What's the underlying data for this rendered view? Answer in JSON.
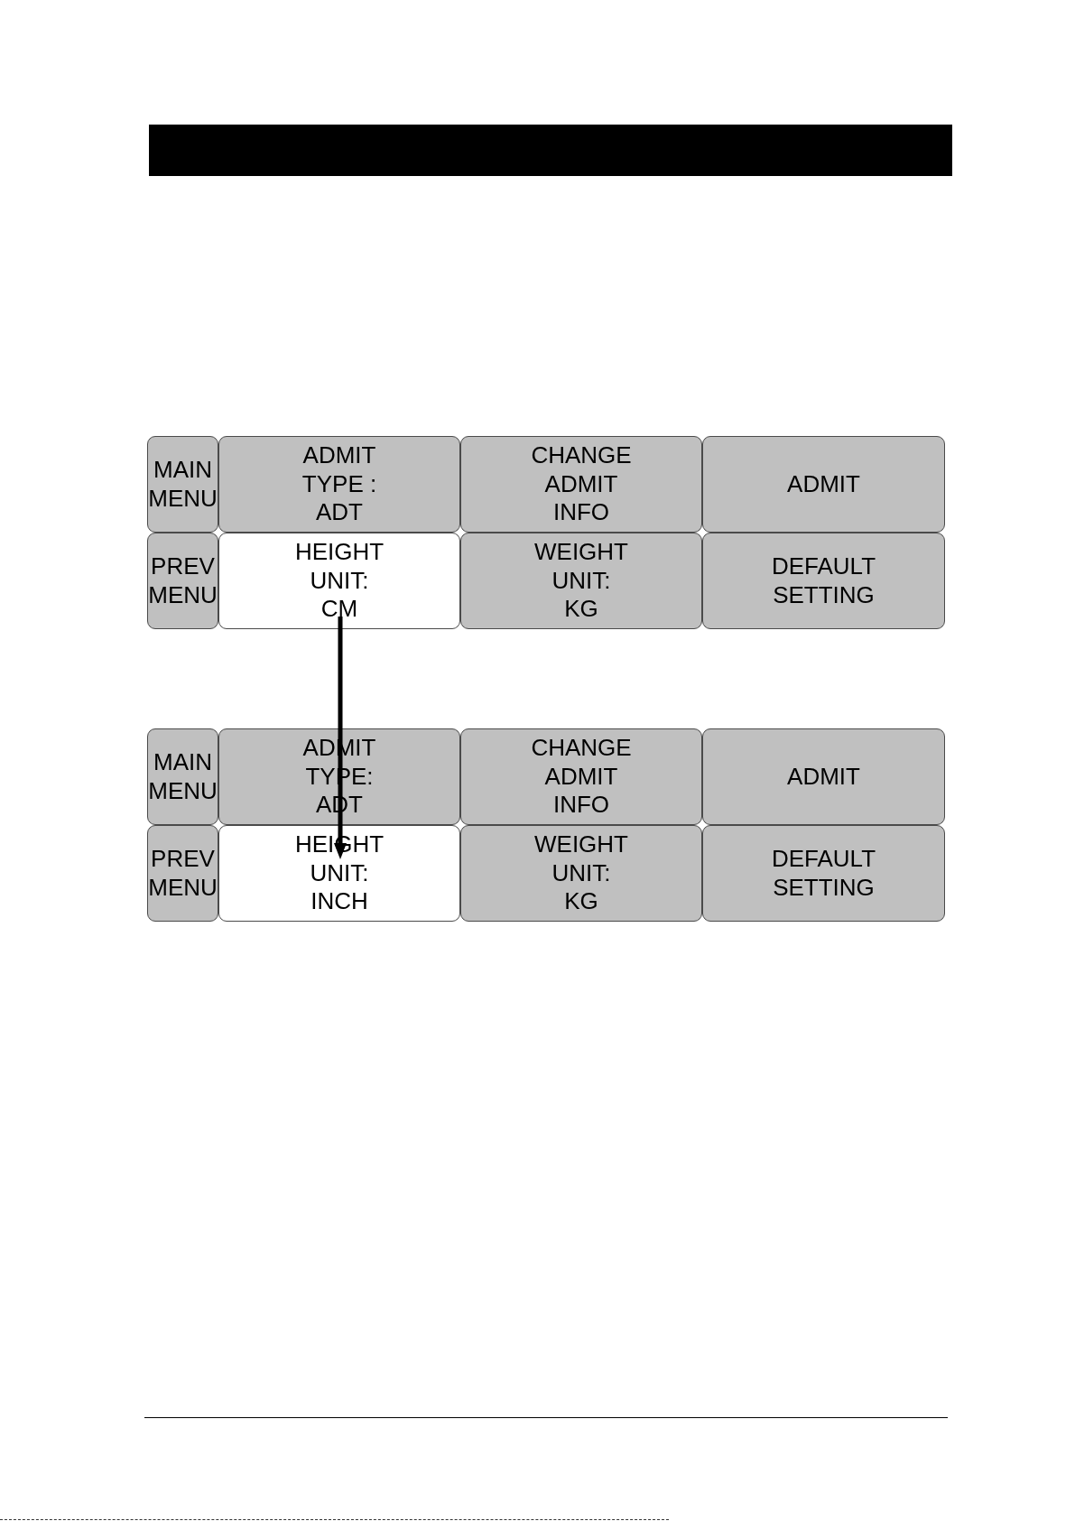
{
  "screens": [
    {
      "rows": [
        {
          "cells": [
            {
              "lines": [
                "MAIN",
                "MENU"
              ],
              "selected": false
            },
            {
              "lines": [
                "ADMIT",
                "TYPE :",
                "ADT"
              ],
              "selected": false
            },
            {
              "lines": [
                "CHANGE",
                "ADMIT",
                "INFO"
              ],
              "selected": false
            },
            {
              "lines": [
                "ADMIT"
              ],
              "selected": false
            }
          ]
        },
        {
          "cells": [
            {
              "lines": [
                "PREV",
                "MENU"
              ],
              "selected": false
            },
            {
              "lines": [
                "HEIGHT",
                "UNIT:",
                "CM"
              ],
              "selected": true
            },
            {
              "lines": [
                "WEIGHT",
                "UNIT:",
                "KG"
              ],
              "selected": false
            },
            {
              "lines": [
                "DEFAULT",
                "SETTING"
              ],
              "selected": false
            }
          ]
        }
      ]
    },
    {
      "rows": [
        {
          "cells": [
            {
              "lines": [
                "MAIN",
                "MENU"
              ],
              "selected": false
            },
            {
              "lines": [
                "ADMIT",
                "TYPE:",
                "ADT"
              ],
              "selected": false
            },
            {
              "lines": [
                "CHANGE",
                "ADMIT",
                "INFO"
              ],
              "selected": false
            },
            {
              "lines": [
                "ADMIT"
              ],
              "selected": false
            }
          ]
        },
        {
          "cells": [
            {
              "lines": [
                "PREV",
                "MENU"
              ],
              "selected": false
            },
            {
              "lines": [
                "HEIGHT",
                "UNIT:",
                "INCH"
              ],
              "selected": true
            },
            {
              "lines": [
                "WEIGHT",
                "UNIT:",
                "KG"
              ],
              "selected": false
            },
            {
              "lines": [
                "DEFAULT",
                "SETTING"
              ],
              "selected": false
            }
          ]
        }
      ]
    }
  ]
}
